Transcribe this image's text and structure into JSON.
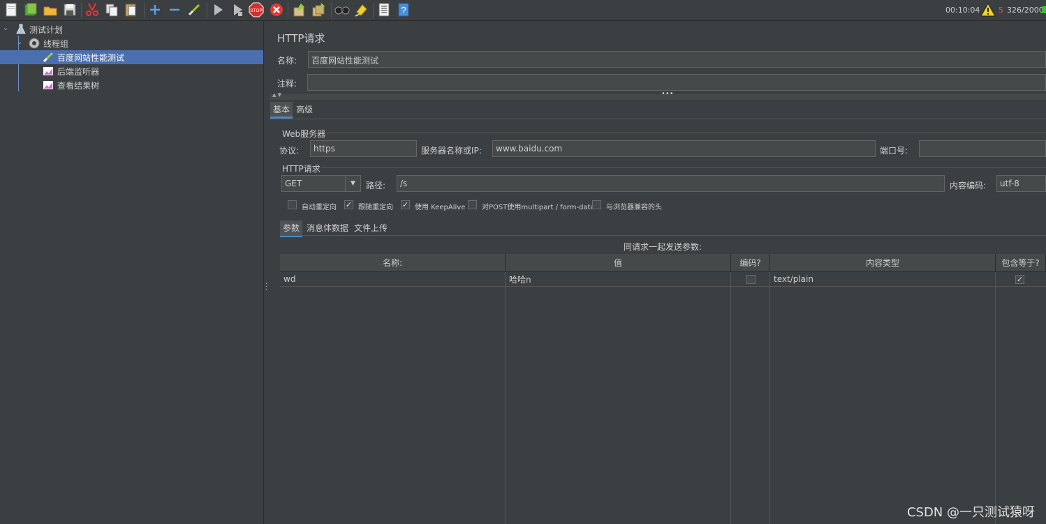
{
  "toolbar": {
    "icons": [
      "new-icon",
      "templates-icon",
      "open-icon",
      "save-icon",
      "cut-icon",
      "copy-icon",
      "paste-icon",
      "expand-icon",
      "collapse-icon",
      "toggle-icon",
      "start-icon",
      "start-no-pause-icon",
      "stop-icon",
      "shutdown-icon",
      "clear-icon",
      "clear-all-icon",
      "search-icon",
      "reset-search-icon",
      "function-helper-icon",
      "help-icon"
    ],
    "stop_label": "STOP",
    "time": "00:10:04",
    "errors": "5",
    "threads": "326/2000"
  },
  "tree": {
    "items": [
      {
        "label": "测试计划",
        "icon": "test-plan-icon"
      },
      {
        "label": "线程组",
        "icon": "thread-group-icon"
      },
      {
        "label": "百度网站性能测试",
        "icon": "http-sampler-icon"
      },
      {
        "label": "后端监听器",
        "icon": "listener-icon"
      },
      {
        "label": "查看结果树",
        "icon": "listener-icon"
      }
    ]
  },
  "panel": {
    "title": "HTTP请求",
    "name_label": "名称:",
    "name_value": "百度网站性能测试",
    "comment_label": "注释:",
    "comment_value": "",
    "tabs": [
      "基本",
      "高级"
    ],
    "web_server": {
      "group_title": "Web服务器",
      "protocol_label": "协议:",
      "protocol_value": "https",
      "server_label": "服务器名称或IP:",
      "server_value": "www.baidu.com",
      "port_label": "端口号:",
      "port_value": ""
    },
    "http_request": {
      "group_title": "HTTP请求",
      "method_value": "GET",
      "path_label": "路径:",
      "path_value": "/s",
      "encoding_label": "内容编码:",
      "encoding_value": "utf-8"
    },
    "options": [
      {
        "label": "自动重定向",
        "checked": false
      },
      {
        "label": "跟随重定向",
        "checked": true
      },
      {
        "label": "使用 KeepAlive",
        "checked": true
      },
      {
        "label": "对POST使用multipart / form-data",
        "checked": false
      },
      {
        "label": "与浏览器兼容的头",
        "checked": false
      }
    ],
    "sub_tabs": [
      "参数",
      "消息体数据",
      "文件上传"
    ],
    "params_caption": "同请求一起发送参数:",
    "table": {
      "headers": [
        "名称:",
        "值",
        "编码?",
        "内容类型",
        "包含等于?"
      ],
      "rows": [
        {
          "name": "wd",
          "value": "哈哈n",
          "encode": false,
          "content_type": "text/plain",
          "include_equals": true
        }
      ]
    }
  },
  "watermark": "CSDN @一只测试猿呀",
  "colors": {
    "selection": "#4b6eaf",
    "background": "#3c3f41",
    "field": "#45494a",
    "error": "#e05050",
    "accent": "#4a88c7"
  }
}
